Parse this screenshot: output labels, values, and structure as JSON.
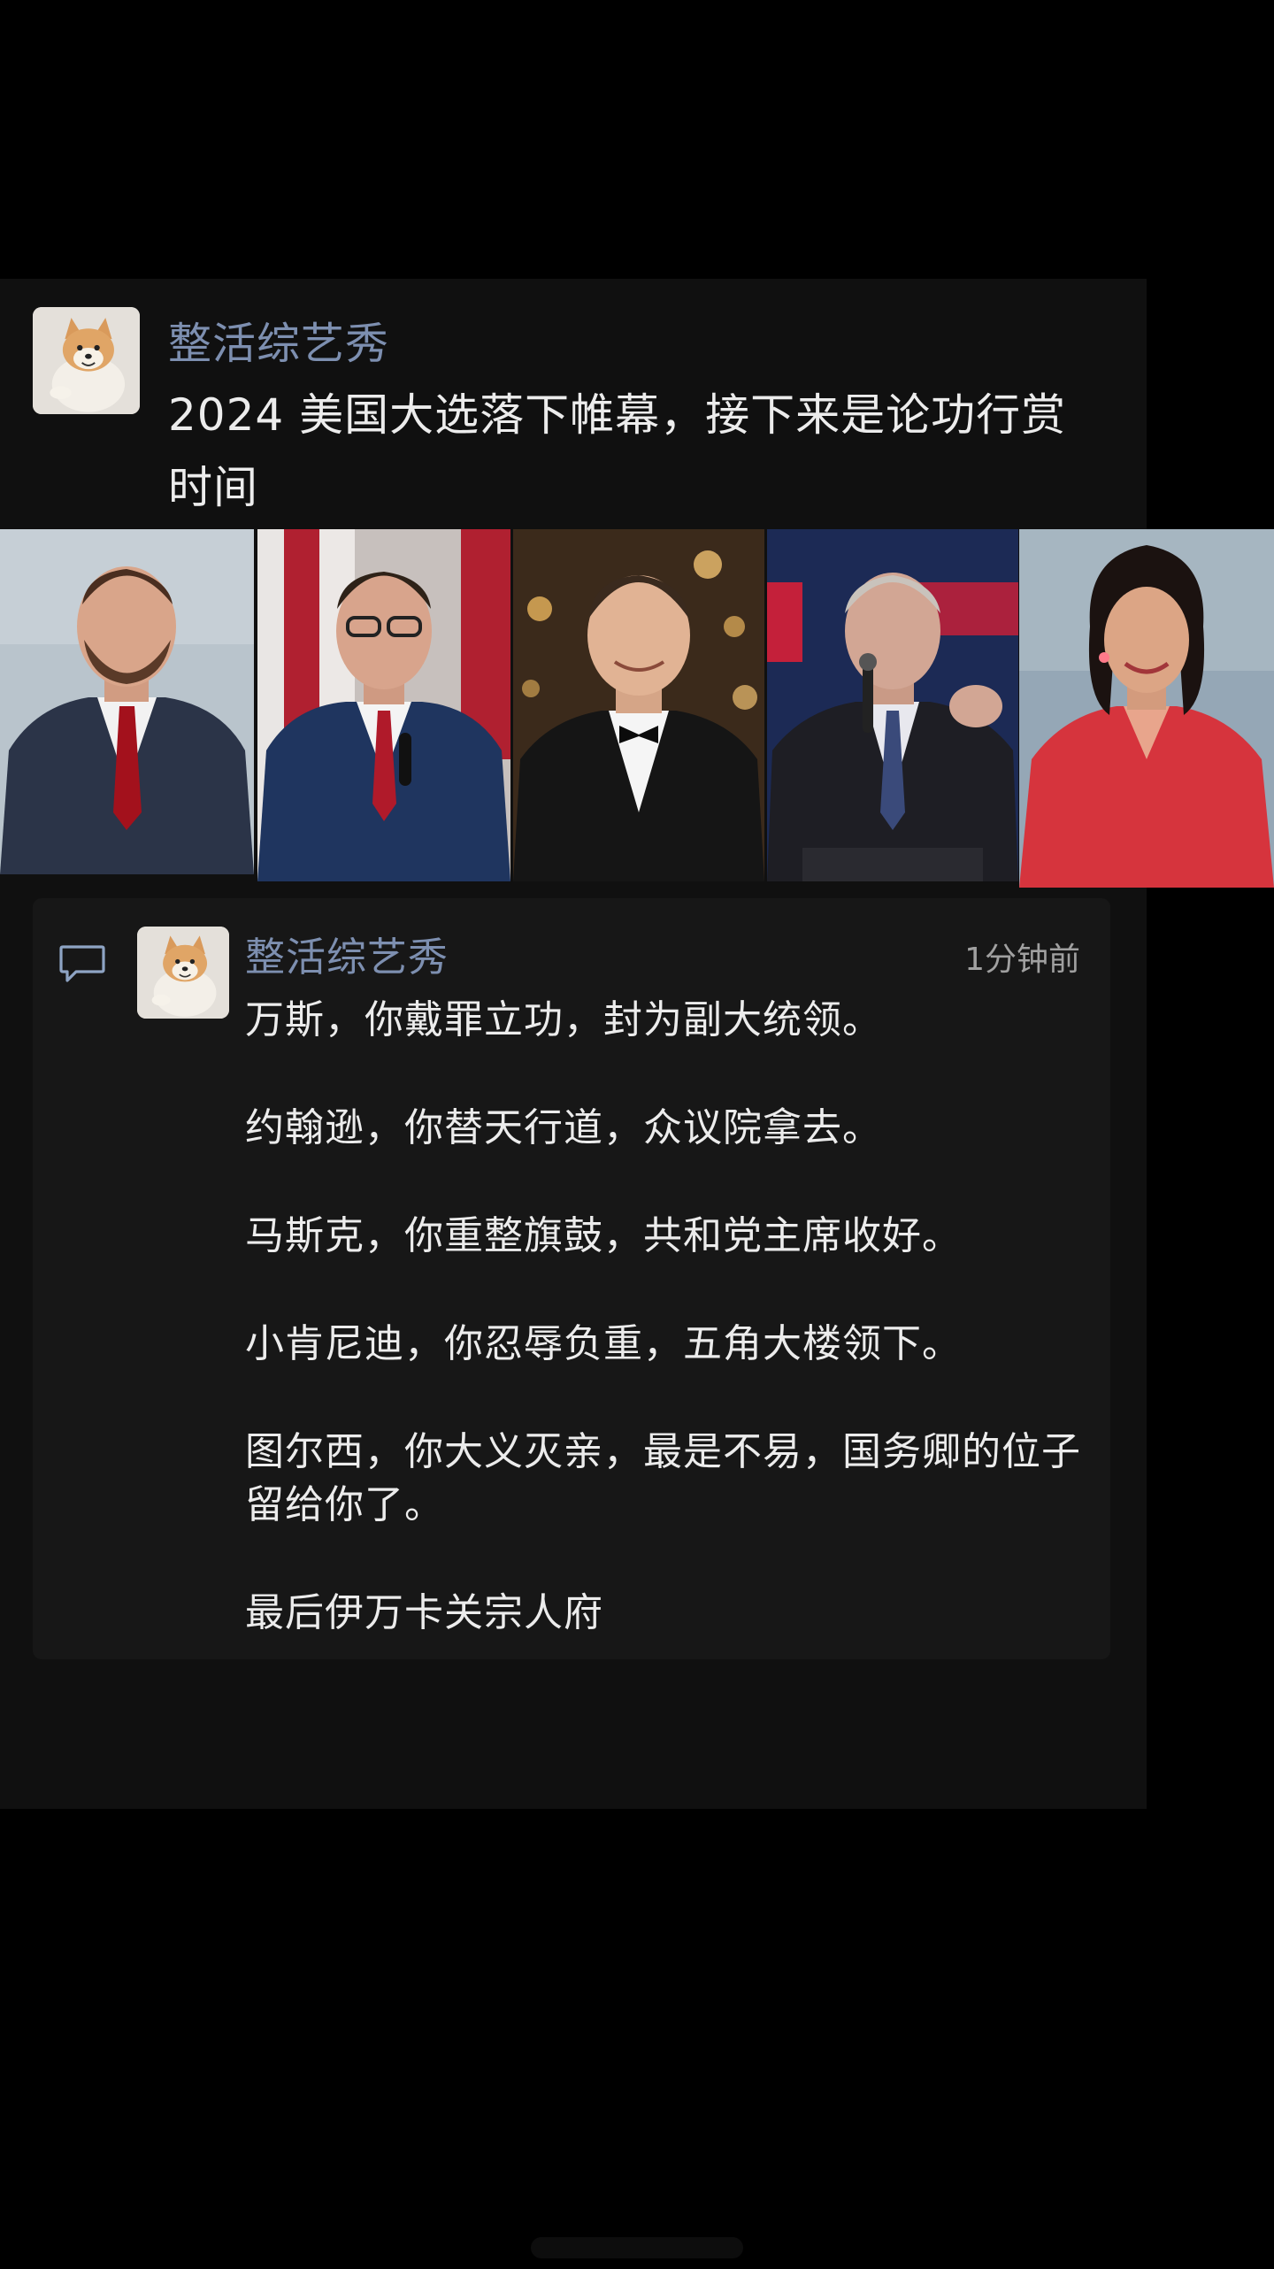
{
  "post": {
    "author": "整活综艺秀",
    "text": "2024 美国大选落下帷幕，接下来是论功行赏时间"
  },
  "photos": [
    {
      "name": "person-1-photo",
      "background": "#b9c4cc",
      "suit": "#2b3448",
      "tie": "#a3111c"
    },
    {
      "name": "person-2-photo",
      "background": "#c7c0bd",
      "suit": "#1f355f",
      "tie": "#b01a2a"
    },
    {
      "name": "person-3-photo",
      "background": "#3b2a1b",
      "suit": "#151515",
      "tie": "#0b0b0b"
    },
    {
      "name": "person-4-photo",
      "background": "#1c2a55",
      "suit": "#1e1e24",
      "tie": "#3a4a7a"
    },
    {
      "name": "person-5-photo",
      "background": "#95a7b6",
      "suit": "#d6343d",
      "tie": "#d6343d"
    }
  ],
  "comment": {
    "author": "整活综艺秀",
    "time": "1分钟前",
    "lines": [
      "万斯，你戴罪立功，封为副大统领。",
      "约翰逊，你替天行道，众议院拿去。",
      "马斯克，你重整旗鼓，共和党主席收好。",
      "小肯尼迪，你忍辱负重，五角大楼领下。",
      "图尔西，你大义灭亲，最是不易，国务卿的位子留给你了。",
      "最后伊万卡关宗人府"
    ]
  },
  "colors": {
    "page_background": "#000000",
    "card_background": "#101010",
    "comment_background": "#171717",
    "author_name": "#7d8fb0",
    "body_text": "#ececec",
    "timestamp": "#a0a0a0"
  },
  "icons": {
    "comment": "speech-bubble-icon",
    "avatar": "shiba-dog-avatar"
  }
}
